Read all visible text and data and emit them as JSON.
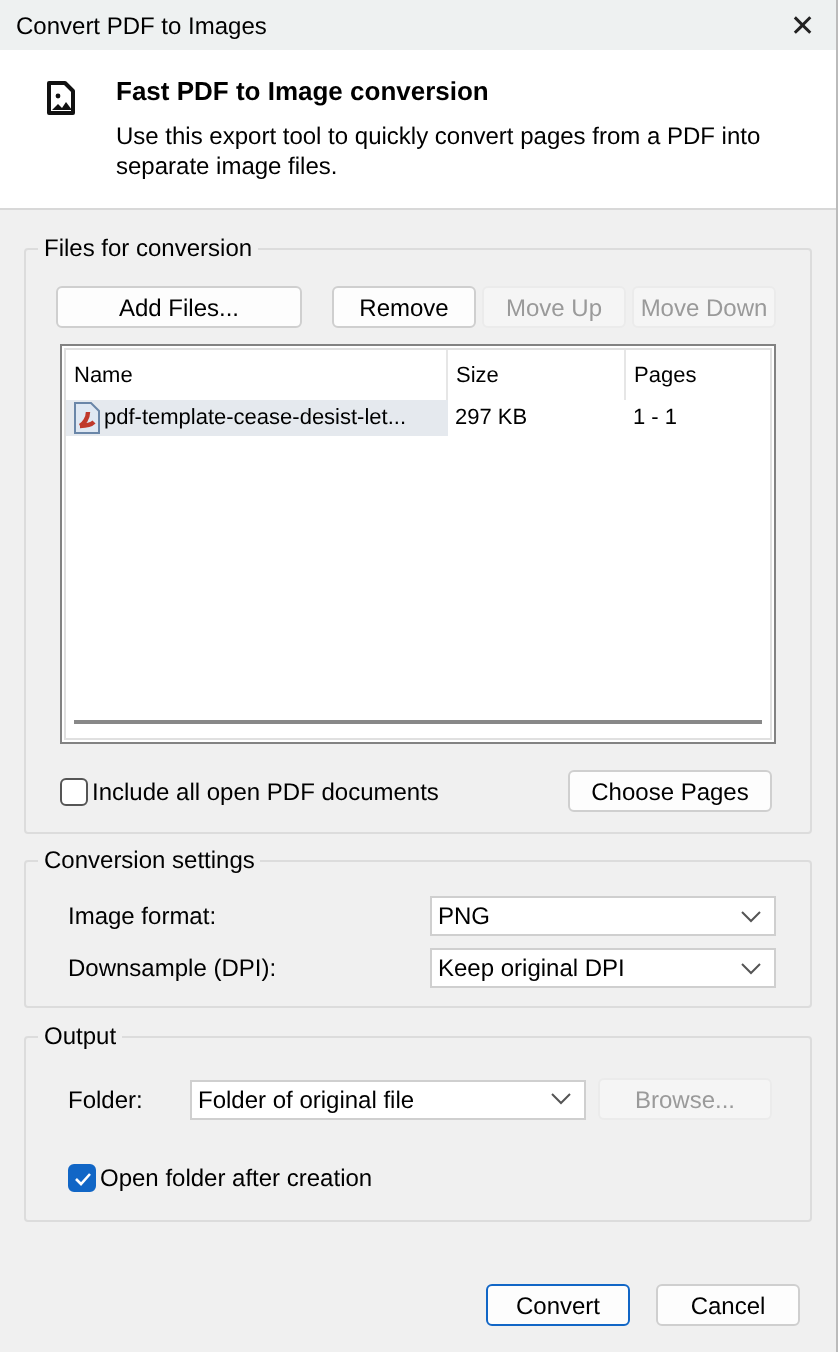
{
  "window": {
    "title": "Convert PDF to Images",
    "close": "✕"
  },
  "header": {
    "title": "Fast PDF to Image conversion",
    "description": "Use this export tool to quickly convert pages from a PDF into separate image files."
  },
  "files_group": {
    "legend": "Files for conversion",
    "buttons": [
      {
        "label": "Add Files...",
        "disabled": false
      },
      {
        "label": "Remove",
        "disabled": false
      },
      {
        "label": "Move Up",
        "disabled": true
      },
      {
        "label": "Move Down",
        "disabled": true
      }
    ],
    "table": {
      "columns": [
        "Name",
        "Size",
        "Pages"
      ],
      "rows": [
        {
          "cells": [
            "pdf-template-cease-desist-let...",
            "297 KB",
            "1 - 1"
          ],
          "selected": true
        }
      ]
    },
    "include_all": {
      "label": "Include all open PDF documents",
      "checked": false
    },
    "choose_pages": {
      "label": "Choose Pages",
      "disabled": false
    }
  },
  "conversion_group": {
    "legend": "Conversion settings",
    "fields": [
      {
        "label": "Image format:",
        "value": "PNG"
      },
      {
        "label": "Downsample (DPI):",
        "value": "Keep original DPI"
      }
    ]
  },
  "output_group": {
    "legend": "Output",
    "folder": {
      "label": "Folder:",
      "value": "Folder of original file"
    },
    "browse": {
      "label": "Browse...",
      "disabled": true
    },
    "open_folder": {
      "label": "Open folder after creation",
      "checked": true
    }
  },
  "footer_buttons": [
    {
      "label": "Convert",
      "default": true
    },
    {
      "label": "Cancel",
      "default": false
    }
  ]
}
